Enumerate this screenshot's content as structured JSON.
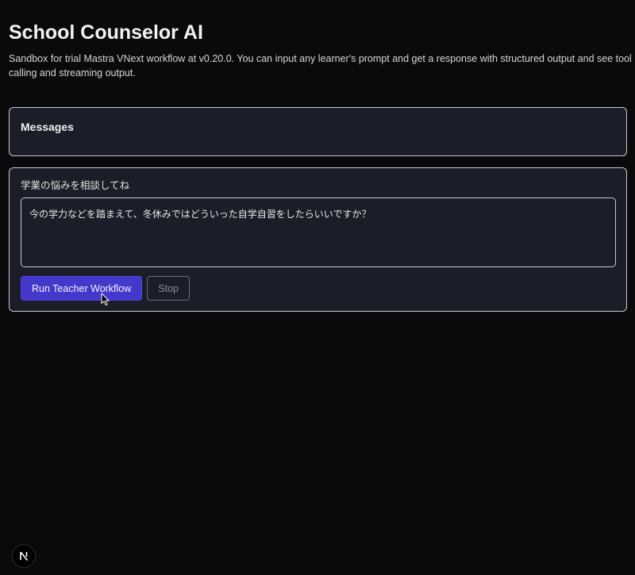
{
  "header": {
    "title": "School Counselor AI",
    "subtitle": "Sandbox for trial Mastra VNext workflow at v0.20.0. You can input any learner's prompt and get a response with structured output and see tool calling and streaming output."
  },
  "messages": {
    "title": "Messages"
  },
  "form": {
    "label": "学業の悩みを相談してね",
    "prompt_value": "今の学力などを踏まえて、冬休みではどういった自学自習をしたらいいですか？",
    "run_label": "Run Teacher Workflow",
    "stop_label": "Stop"
  },
  "icons": {
    "cursor": "mouse-pointer-icon",
    "dev_badge": "nextjs-logo-icon"
  },
  "colors": {
    "background": "#0a0a0c",
    "panel": "#1b1e29",
    "accent": "#4338ca"
  }
}
